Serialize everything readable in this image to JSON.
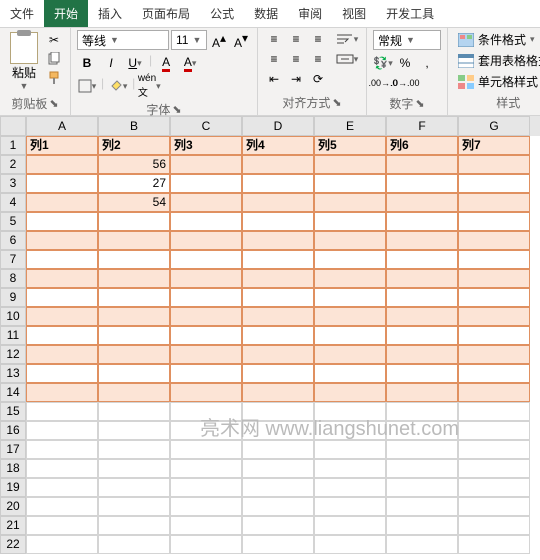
{
  "tabs": [
    "文件",
    "开始",
    "插入",
    "页面布局",
    "公式",
    "数据",
    "审阅",
    "视图",
    "开发工具"
  ],
  "activeTab": 1,
  "ribbon": {
    "clipboard": {
      "paste": "粘贴",
      "label": "剪贴板"
    },
    "font": {
      "name": "等线",
      "size": "11",
      "label": "字体",
      "bold": "B",
      "italic": "I",
      "underline": "U"
    },
    "align": {
      "label": "对齐方式"
    },
    "number": {
      "format": "常规",
      "label": "数字"
    },
    "styles": {
      "cond": "条件格式",
      "table": "套用表格格式",
      "cell": "单元格样式",
      "label": "样式"
    }
  },
  "cols": [
    "A",
    "B",
    "C",
    "D",
    "E",
    "F",
    "G"
  ],
  "headers": [
    "列1",
    "列2",
    "列3",
    "列4",
    "列5",
    "列6",
    "列7"
  ],
  "data": {
    "B2": "56",
    "B3": "27",
    "B4": "54"
  },
  "rowCount": 22,
  "tableRows": 14,
  "watermark": "亮术网 www.liangshunet.com",
  "chart_data": {
    "type": "table",
    "title": "",
    "columns": [
      "列1",
      "列2",
      "列3",
      "列4",
      "列5",
      "列6",
      "列7"
    ],
    "rows": [
      [
        null,
        56,
        null,
        null,
        null,
        null,
        null
      ],
      [
        null,
        27,
        null,
        null,
        null,
        null,
        null
      ],
      [
        null,
        54,
        null,
        null,
        null,
        null,
        null
      ]
    ]
  }
}
